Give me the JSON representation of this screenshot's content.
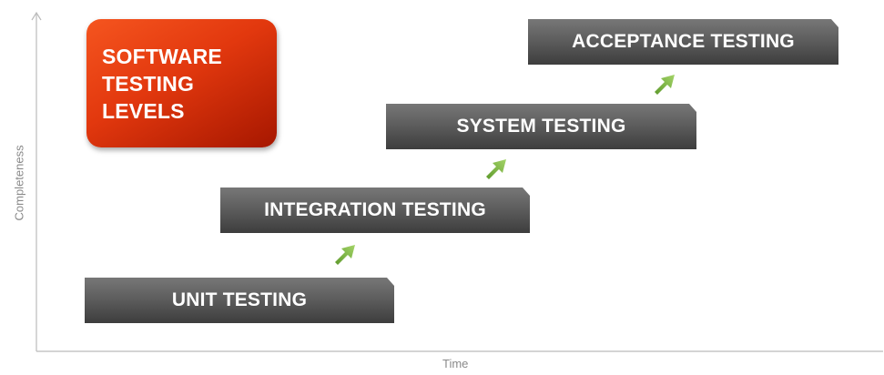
{
  "title": "SOFTWARE\nTESTING\nLEVELS",
  "axes": {
    "x_label": "Time",
    "y_label": "Completeness"
  },
  "steps": [
    {
      "label": "UNIT TESTING"
    },
    {
      "label": "INTEGRATION TESTING"
    },
    {
      "label": "SYSTEM TESTING"
    },
    {
      "label": "ACCEPTANCE TESTING"
    }
  ],
  "colors": {
    "title_box": "#e2380e",
    "step_box": "#5e5e5e",
    "arrow": "#7cb342",
    "axis": "#bbbbbb"
  },
  "icons": {
    "arrow": "arrow-up-right-icon"
  }
}
